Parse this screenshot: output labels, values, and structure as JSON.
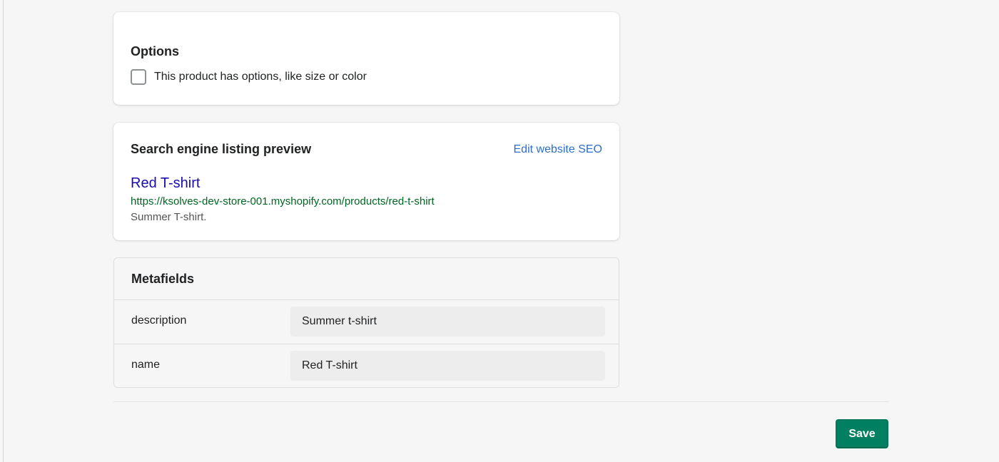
{
  "options": {
    "title": "Options",
    "checkbox_label": "This product has options, like size or color",
    "checked": false
  },
  "seo": {
    "title": "Search engine listing preview",
    "edit_link": "Edit website SEO",
    "preview_title": "Red T-shirt",
    "preview_url": "https://ksolves-dev-store-001.myshopify.com/products/red-t-shirt",
    "preview_description": "Summer T-shirt."
  },
  "metafields": {
    "title": "Metafields",
    "rows": [
      {
        "key": "description",
        "value": "Summer t-shirt"
      },
      {
        "key": "name",
        "value": "Red T-shirt"
      }
    ]
  },
  "footer": {
    "save_label": "Save"
  },
  "colors": {
    "primary": "#008060",
    "link": "#2c6ecb",
    "seo_title": "#1a0dab",
    "seo_url": "#006621"
  }
}
